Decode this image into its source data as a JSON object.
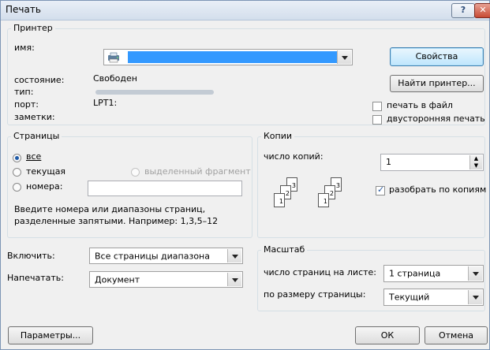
{
  "window": {
    "title": "Печать",
    "help_glyph": "?",
    "close_glyph": "✕"
  },
  "printer": {
    "group_label": "Принтер",
    "name_label": "имя:",
    "status_label": "состояние:",
    "status_value": "Свободен",
    "type_label": "тип:",
    "port_label": "порт:",
    "port_value": "LPT1:",
    "comments_label": "заметки:",
    "properties_button": "Свойства",
    "find_printer_button": "Найти принтер...",
    "print_to_file": {
      "label": "печать в файл",
      "checked": false
    },
    "duplex": {
      "label": "двусторонняя печать",
      "checked": false
    }
  },
  "pages": {
    "group_label": "Страницы",
    "all_label": "все",
    "current_label": "текущая",
    "selection_label": "выделенный фрагмент",
    "pages_label": "номера:",
    "pages_value": "",
    "hint": [
      "Введите номера или диапазоны страниц,",
      "разделенные запятыми. Например: 1,3,5–12"
    ]
  },
  "copies": {
    "group_label": "Копии",
    "count_label": "число копий:",
    "count_value": "1",
    "collate": {
      "label": "разобрать по копиям",
      "checked": true
    },
    "icon_pages": [
      "3",
      "2",
      "1",
      "3",
      "2",
      "1"
    ]
  },
  "include": {
    "label": "Включить:",
    "value": "Все страницы диапазона"
  },
  "print_what": {
    "label": "Напечатать:",
    "value": "Документ"
  },
  "zoom": {
    "group_label": "Масштаб",
    "pages_per_sheet_label": "число страниц на листе:",
    "pages_per_sheet_value": "1 страница",
    "scale_label": "по размеру страницы:",
    "scale_value": "Текущий"
  },
  "footer": {
    "options_button": "Параметры...",
    "ok_button": "ОК",
    "cancel_button": "Отмена"
  }
}
